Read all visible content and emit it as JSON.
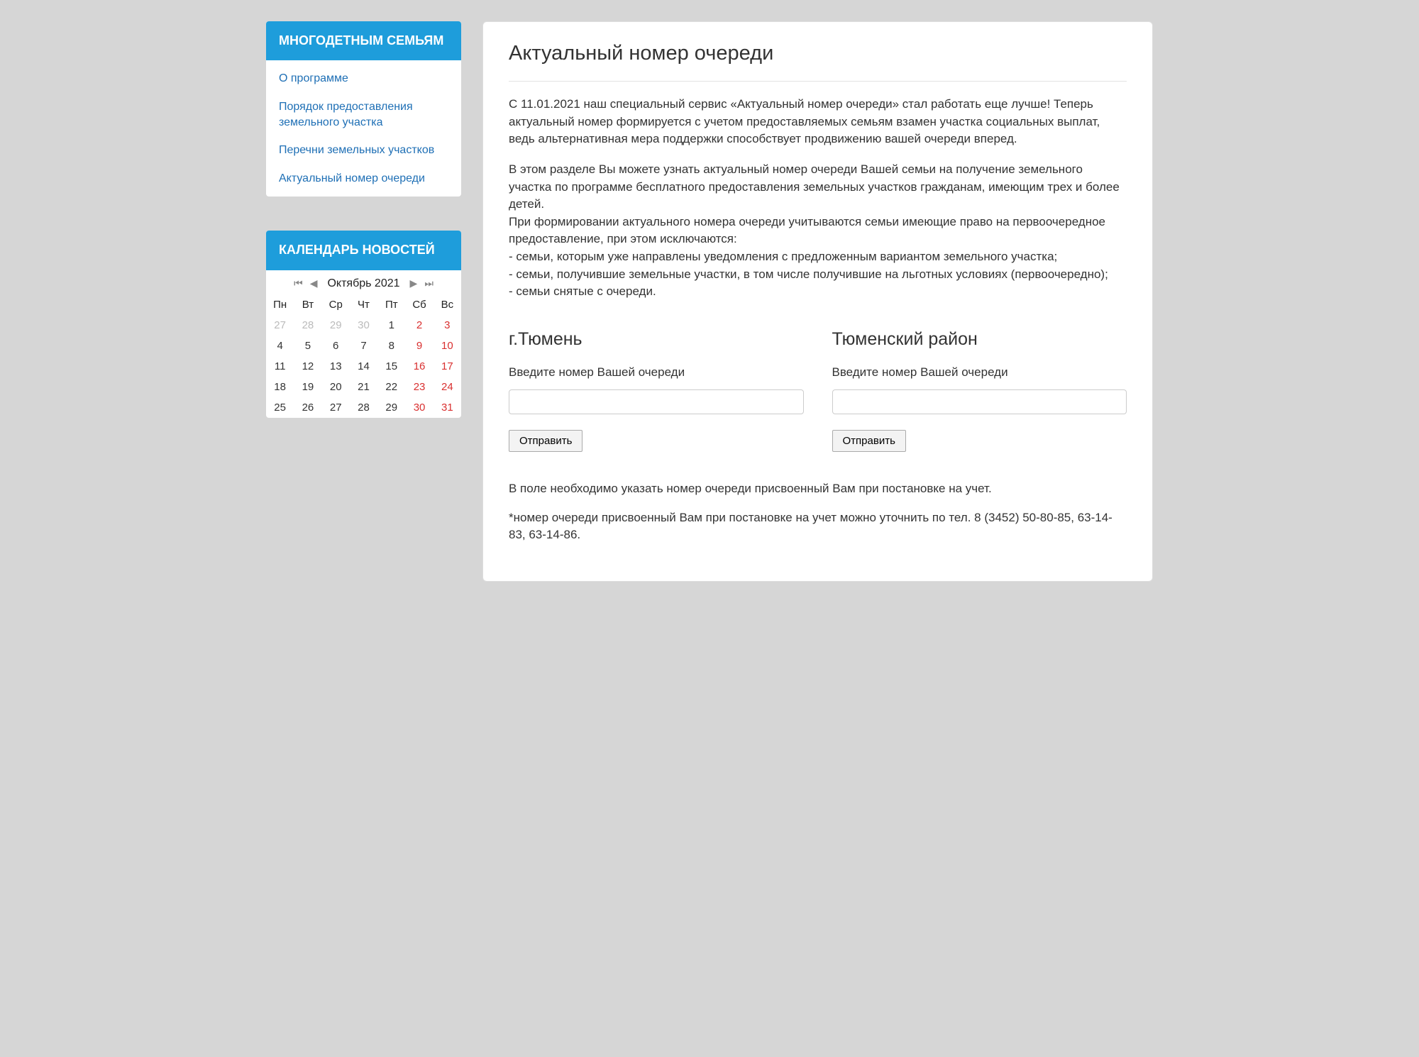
{
  "sidebar": {
    "menu": {
      "title": "МНОГОДЕТНЫМ СЕМЬЯМ",
      "items": [
        "О программе",
        "Порядок предоставления земельного участка",
        "Перечни земельных участков",
        "Актуальный номер очереди"
      ]
    },
    "calendar": {
      "title": "КАЛЕНДАРЬ НОВОСТЕЙ",
      "month_label": "Октябрь 2021",
      "weekdays": [
        "Пн",
        "Вт",
        "Ср",
        "Чт",
        "Пт",
        "Сб",
        "Вс"
      ],
      "rows": [
        [
          {
            "d": "27",
            "cls": "other"
          },
          {
            "d": "28",
            "cls": "other"
          },
          {
            "d": "29",
            "cls": "other"
          },
          {
            "d": "30",
            "cls": "other"
          },
          {
            "d": "1",
            "cls": ""
          },
          {
            "d": "2",
            "cls": "wkend"
          },
          {
            "d": "3",
            "cls": "wkend"
          }
        ],
        [
          {
            "d": "4",
            "cls": ""
          },
          {
            "d": "5",
            "cls": ""
          },
          {
            "d": "6",
            "cls": ""
          },
          {
            "d": "7",
            "cls": ""
          },
          {
            "d": "8",
            "cls": ""
          },
          {
            "d": "9",
            "cls": "wkend"
          },
          {
            "d": "10",
            "cls": "wkend"
          }
        ],
        [
          {
            "d": "11",
            "cls": ""
          },
          {
            "d": "12",
            "cls": ""
          },
          {
            "d": "13",
            "cls": ""
          },
          {
            "d": "14",
            "cls": ""
          },
          {
            "d": "15",
            "cls": ""
          },
          {
            "d": "16",
            "cls": "wkend"
          },
          {
            "d": "17",
            "cls": "wkend"
          }
        ],
        [
          {
            "d": "18",
            "cls": ""
          },
          {
            "d": "19",
            "cls": ""
          },
          {
            "d": "20",
            "cls": ""
          },
          {
            "d": "21",
            "cls": ""
          },
          {
            "d": "22",
            "cls": ""
          },
          {
            "d": "23",
            "cls": "wkend"
          },
          {
            "d": "24",
            "cls": "wkend"
          }
        ],
        [
          {
            "d": "25",
            "cls": ""
          },
          {
            "d": "26",
            "cls": ""
          },
          {
            "d": "27",
            "cls": ""
          },
          {
            "d": "28",
            "cls": ""
          },
          {
            "d": "29",
            "cls": ""
          },
          {
            "d": "30",
            "cls": "wkend"
          },
          {
            "d": "31",
            "cls": "wkend"
          }
        ]
      ]
    }
  },
  "main": {
    "title": "Актуальный номер очереди",
    "p1": "С 11.01.2021 наш специальный сервис «Актуальный номер очереди» стал работать еще лучше! Теперь актуальный номер формируется с учетом предоставляемых семьям взамен участка социальных выплат, ведь альтернативная мера поддержки способствует продвижению вашей очереди вперед.",
    "p2": "В этом разделе Вы можете узнать актуальный номер очереди Вашей семьи на получение земельного участка по программе бесплатного предоставления земельных участков гражданам, имеющим трех и более детей.\nПри формировании актуального номера очереди учитываются семьи имеющие право на первоочередное предоставление, при этом исключаются:\n- семьи, которым уже направлены уведомления с предложенным вариантом земельного участка;\n- семьи, получившие земельные участки, в том числе получившие на льготных условиях (первоочередно);\n- семьи снятые с очереди.",
    "forms": [
      {
        "heading": "г.Тюмень",
        "label": "Введите номер Вашей очереди",
        "button": "Отправить"
      },
      {
        "heading": "Тюменский район",
        "label": "Введите номер Вашей очереди",
        "button": "Отправить"
      }
    ],
    "note1": " В поле необходимо указать номер очереди присвоенный Вам при постановке на учет.",
    "note2": "*номер очереди присвоенный Вам при постановке на учет можно уточнить по тел. 8 (3452) 50-80-85, 63-14-83, 63-14-86."
  }
}
